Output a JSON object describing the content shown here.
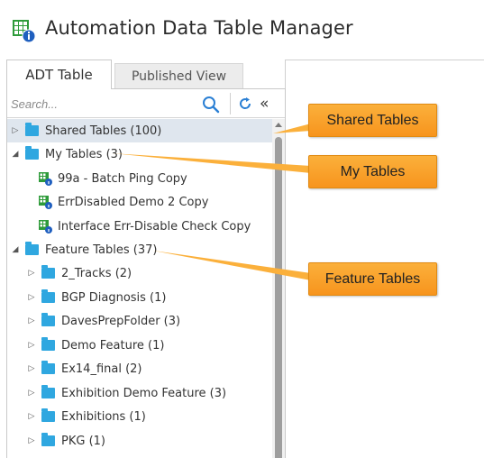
{
  "app": {
    "title": "Automation Data Table Manager",
    "icon": "table-info-icon"
  },
  "tabs": [
    {
      "label": "ADT Table",
      "active": true
    },
    {
      "label": "Published View",
      "active": false
    }
  ],
  "search": {
    "placeholder": "Search...",
    "value": ""
  },
  "tree": {
    "shared": {
      "label": "Shared Tables (100)",
      "expanded": false,
      "selected": true
    },
    "my": {
      "label": "My Tables (3)",
      "expanded": true,
      "items": [
        "99a - Batch Ping Copy",
        "ErrDisabled Demo 2 Copy",
        "Interface Err-Disable Check Copy"
      ]
    },
    "feature": {
      "label": "Feature Tables (37)",
      "expanded": true,
      "items": [
        "2_Tracks (2)",
        "BGP Diagnosis (1)",
        "DavesPrepFolder (3)",
        "Demo Feature (1)",
        "Ex14_final (2)",
        "Exhibition Demo Feature (3)",
        "Exhibitions (1)",
        "PKG (1)"
      ]
    }
  },
  "callouts": {
    "shared": "Shared Tables",
    "my": "My Tables",
    "feature": "Feature Tables"
  },
  "colors": {
    "folder": "#2fa7e0",
    "callout": "#f7941d",
    "selection": "#dfe6ee",
    "table_icon_green": "#2e9b3a",
    "table_icon_badge": "#1f5fbf"
  }
}
